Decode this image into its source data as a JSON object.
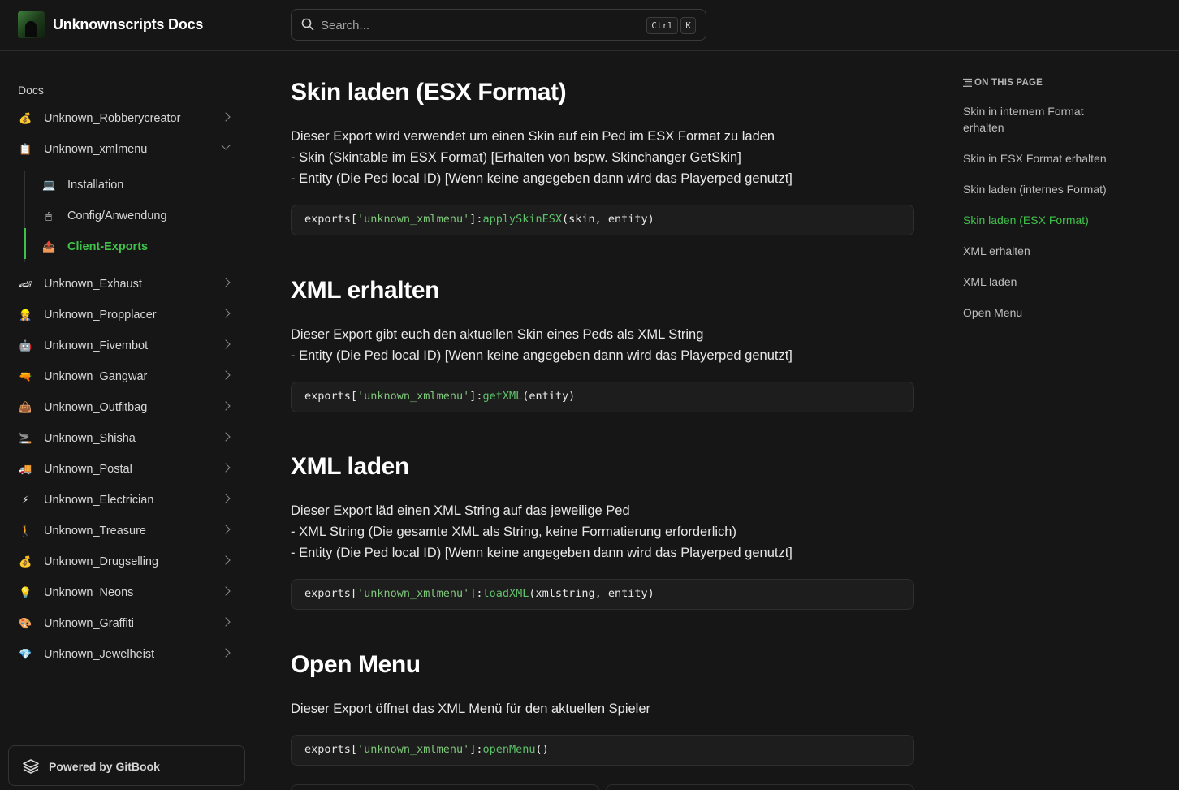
{
  "header": {
    "brand": "Unknownscripts Docs",
    "search_placeholder": "Search...",
    "shortcut_ctrl": "Ctrl",
    "shortcut_k": "K"
  },
  "sidebar": {
    "section_title": "Docs",
    "items": [
      {
        "icon": "💰",
        "label": "Unknown_Robberycreator"
      },
      {
        "icon": "📋",
        "label": "Unknown_xmlmenu"
      },
      {
        "icon": "🏎",
        "label": "Unknown_Exhaust"
      },
      {
        "icon": "👷",
        "label": "Unknown_Propplacer"
      },
      {
        "icon": "🤖",
        "label": "Unknown_Fivembot"
      },
      {
        "icon": "🔫",
        "label": "Unknown_Gangwar"
      },
      {
        "icon": "👜",
        "label": "Unknown_Outfitbag"
      },
      {
        "icon": "🚬",
        "label": "Unknown_Shisha"
      },
      {
        "icon": "🚚",
        "label": "Unknown_Postal"
      },
      {
        "icon": "⚡",
        "label": "Unknown_Electrician"
      },
      {
        "icon": "🚶",
        "label": "Unknown_Treasure"
      },
      {
        "icon": "💰",
        "label": "Unknown_Drugselling"
      },
      {
        "icon": "💡",
        "label": "Unknown_Neons"
      },
      {
        "icon": "🎨",
        "label": "Unknown_Graffiti"
      },
      {
        "icon": "💎",
        "label": "Unknown_Jewelheist"
      }
    ],
    "subitems": [
      {
        "icon": "💻",
        "label": "Installation"
      },
      {
        "icon": "🖱",
        "label": "Config/Anwendung"
      },
      {
        "icon": "📤",
        "label": "Client-Exports"
      }
    ],
    "powered_by": "Powered by GitBook"
  },
  "main": {
    "sections": [
      {
        "title": "Skin laden (ESX Format)",
        "lines": [
          "Dieser Export wird verwendet um einen Skin auf ein Ped im ESX Format zu laden",
          "- Skin (Skintable im ESX Format) [Erhalten von bspw. Skinchanger GetSkin]",
          "- Entity (Die Ped local ID) [Wenn keine angegeben dann wird das Playerped genutzt]"
        ],
        "code": {
          "prefix": "exports[",
          "str": "'unknown_xmlmenu'",
          "mid": "]:",
          "fn": "applySkinESX",
          "args": "(skin, entity)"
        }
      },
      {
        "title": "XML erhalten",
        "lines": [
          "Dieser Export gibt euch den aktuellen Skin eines Peds als XML String",
          "- Entity (Die Ped local ID) [Wenn keine angegeben dann wird das Playerped genutzt]"
        ],
        "code": {
          "prefix": "exports[",
          "str": "'unknown_xmlmenu'",
          "mid": "]:",
          "fn": "getXML",
          "args": "(entity)"
        }
      },
      {
        "title": "XML laden",
        "lines": [
          "Dieser Export läd einen XML String auf das jeweilige Ped",
          "- XML String (Die gesamte XML als String, keine Formatierung erforderlich)",
          "- Entity (Die Ped local ID) [Wenn keine angegeben dann wird das Playerped genutzt]"
        ],
        "code": {
          "prefix": "exports[",
          "str": "'unknown_xmlmenu'",
          "mid": "]:",
          "fn": "loadXML",
          "args": "(xmlstring, entity)"
        }
      },
      {
        "title": "Open Menu",
        "lines": [
          "Dieser Export öffnet das XML Menü für den aktuellen Spieler"
        ],
        "code": {
          "prefix": "exports[",
          "str": "'unknown_xmlmenu'",
          "mid": "]:",
          "fn": "openMenu",
          "args": "()"
        }
      }
    ]
  },
  "toc": {
    "heading": "ON THIS PAGE",
    "items": [
      "Skin in internem Format erhalten",
      "Skin in ESX Format erhalten",
      "Skin laden (internes Format)",
      "Skin laden (ESX Format)",
      "XML erhalten",
      "XML laden",
      "Open Menu"
    ]
  },
  "colors": {
    "accent": "#3fc24a",
    "background": "#161616",
    "code_background": "#1d1d1d"
  }
}
